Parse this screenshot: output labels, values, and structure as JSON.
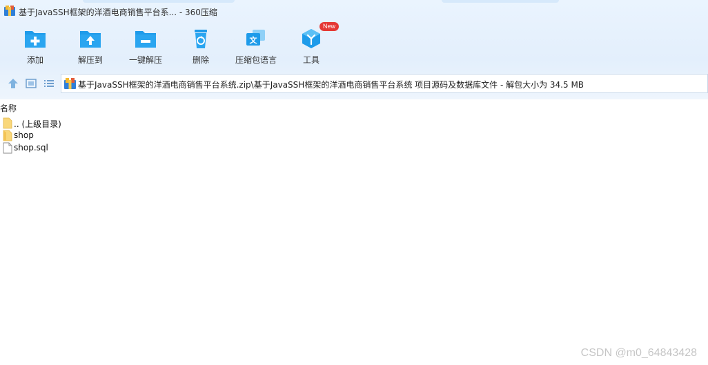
{
  "title_bar": {
    "title": "基于JavaSSH框架的洋酒电商销售平台系... - 360压缩"
  },
  "toolbar": {
    "add": "添加",
    "extract_to": "解压到",
    "one_click_extract": "一键解压",
    "delete": "删除",
    "language_pack": "压缩包语言",
    "tools": "工具",
    "tools_badge": "New"
  },
  "address": {
    "path": "基于JavaSSH框架的洋酒电商销售平台系统.zip\\基于JavaSSH框架的洋酒电商销售平台系统 项目源码及数据库文件 - 解包大小为 34.5 MB"
  },
  "list": {
    "column_name": "名称",
    "items": [
      {
        "name": ".. (上级目录)",
        "type": "parent-folder"
      },
      {
        "name": "shop",
        "type": "folder"
      },
      {
        "name": "shop.sql",
        "type": "file"
      }
    ]
  },
  "watermark": "CSDN @m0_64843428",
  "colors": {
    "accent": "#1e9bea",
    "toolbar_bg": "#e6f1fc",
    "badge": "#e53935"
  }
}
